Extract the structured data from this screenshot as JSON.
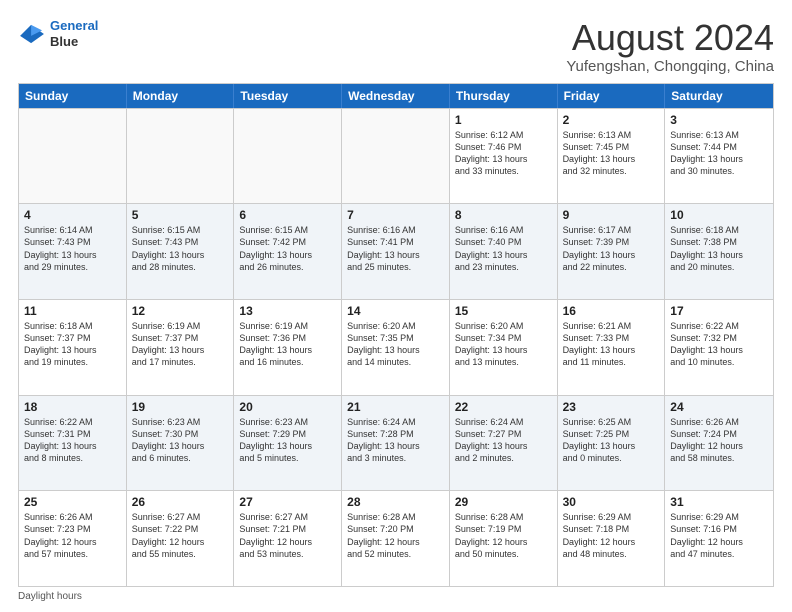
{
  "header": {
    "logo_line1": "General",
    "logo_line2": "Blue",
    "main_title": "August 2024",
    "subtitle": "Yufengshan, Chongqing, China"
  },
  "weekdays": [
    "Sunday",
    "Monday",
    "Tuesday",
    "Wednesday",
    "Thursday",
    "Friday",
    "Saturday"
  ],
  "footer": {
    "daylight_label": "Daylight hours"
  },
  "weeks": [
    [
      {
        "day": "",
        "info": ""
      },
      {
        "day": "",
        "info": ""
      },
      {
        "day": "",
        "info": ""
      },
      {
        "day": "",
        "info": ""
      },
      {
        "day": "1",
        "info": "Sunrise: 6:12 AM\nSunset: 7:46 PM\nDaylight: 13 hours\nand 33 minutes."
      },
      {
        "day": "2",
        "info": "Sunrise: 6:13 AM\nSunset: 7:45 PM\nDaylight: 13 hours\nand 32 minutes."
      },
      {
        "day": "3",
        "info": "Sunrise: 6:13 AM\nSunset: 7:44 PM\nDaylight: 13 hours\nand 30 minutes."
      }
    ],
    [
      {
        "day": "4",
        "info": "Sunrise: 6:14 AM\nSunset: 7:43 PM\nDaylight: 13 hours\nand 29 minutes."
      },
      {
        "day": "5",
        "info": "Sunrise: 6:15 AM\nSunset: 7:43 PM\nDaylight: 13 hours\nand 28 minutes."
      },
      {
        "day": "6",
        "info": "Sunrise: 6:15 AM\nSunset: 7:42 PM\nDaylight: 13 hours\nand 26 minutes."
      },
      {
        "day": "7",
        "info": "Sunrise: 6:16 AM\nSunset: 7:41 PM\nDaylight: 13 hours\nand 25 minutes."
      },
      {
        "day": "8",
        "info": "Sunrise: 6:16 AM\nSunset: 7:40 PM\nDaylight: 13 hours\nand 23 minutes."
      },
      {
        "day": "9",
        "info": "Sunrise: 6:17 AM\nSunset: 7:39 PM\nDaylight: 13 hours\nand 22 minutes."
      },
      {
        "day": "10",
        "info": "Sunrise: 6:18 AM\nSunset: 7:38 PM\nDaylight: 13 hours\nand 20 minutes."
      }
    ],
    [
      {
        "day": "11",
        "info": "Sunrise: 6:18 AM\nSunset: 7:37 PM\nDaylight: 13 hours\nand 19 minutes."
      },
      {
        "day": "12",
        "info": "Sunrise: 6:19 AM\nSunset: 7:37 PM\nDaylight: 13 hours\nand 17 minutes."
      },
      {
        "day": "13",
        "info": "Sunrise: 6:19 AM\nSunset: 7:36 PM\nDaylight: 13 hours\nand 16 minutes."
      },
      {
        "day": "14",
        "info": "Sunrise: 6:20 AM\nSunset: 7:35 PM\nDaylight: 13 hours\nand 14 minutes."
      },
      {
        "day": "15",
        "info": "Sunrise: 6:20 AM\nSunset: 7:34 PM\nDaylight: 13 hours\nand 13 minutes."
      },
      {
        "day": "16",
        "info": "Sunrise: 6:21 AM\nSunset: 7:33 PM\nDaylight: 13 hours\nand 11 minutes."
      },
      {
        "day": "17",
        "info": "Sunrise: 6:22 AM\nSunset: 7:32 PM\nDaylight: 13 hours\nand 10 minutes."
      }
    ],
    [
      {
        "day": "18",
        "info": "Sunrise: 6:22 AM\nSunset: 7:31 PM\nDaylight: 13 hours\nand 8 minutes."
      },
      {
        "day": "19",
        "info": "Sunrise: 6:23 AM\nSunset: 7:30 PM\nDaylight: 13 hours\nand 6 minutes."
      },
      {
        "day": "20",
        "info": "Sunrise: 6:23 AM\nSunset: 7:29 PM\nDaylight: 13 hours\nand 5 minutes."
      },
      {
        "day": "21",
        "info": "Sunrise: 6:24 AM\nSunset: 7:28 PM\nDaylight: 13 hours\nand 3 minutes."
      },
      {
        "day": "22",
        "info": "Sunrise: 6:24 AM\nSunset: 7:27 PM\nDaylight: 13 hours\nand 2 minutes."
      },
      {
        "day": "23",
        "info": "Sunrise: 6:25 AM\nSunset: 7:25 PM\nDaylight: 13 hours\nand 0 minutes."
      },
      {
        "day": "24",
        "info": "Sunrise: 6:26 AM\nSunset: 7:24 PM\nDaylight: 12 hours\nand 58 minutes."
      }
    ],
    [
      {
        "day": "25",
        "info": "Sunrise: 6:26 AM\nSunset: 7:23 PM\nDaylight: 12 hours\nand 57 minutes."
      },
      {
        "day": "26",
        "info": "Sunrise: 6:27 AM\nSunset: 7:22 PM\nDaylight: 12 hours\nand 55 minutes."
      },
      {
        "day": "27",
        "info": "Sunrise: 6:27 AM\nSunset: 7:21 PM\nDaylight: 12 hours\nand 53 minutes."
      },
      {
        "day": "28",
        "info": "Sunrise: 6:28 AM\nSunset: 7:20 PM\nDaylight: 12 hours\nand 52 minutes."
      },
      {
        "day": "29",
        "info": "Sunrise: 6:28 AM\nSunset: 7:19 PM\nDaylight: 12 hours\nand 50 minutes."
      },
      {
        "day": "30",
        "info": "Sunrise: 6:29 AM\nSunset: 7:18 PM\nDaylight: 12 hours\nand 48 minutes."
      },
      {
        "day": "31",
        "info": "Sunrise: 6:29 AM\nSunset: 7:16 PM\nDaylight: 12 hours\nand 47 minutes."
      }
    ]
  ]
}
